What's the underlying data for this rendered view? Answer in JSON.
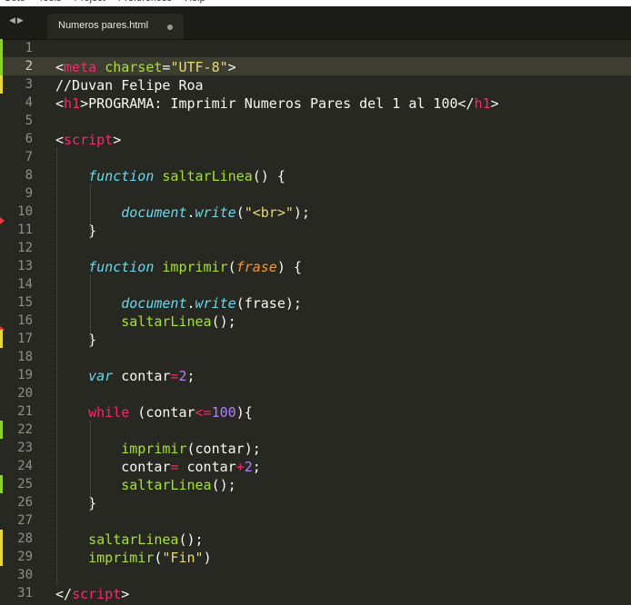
{
  "menu": [
    "Goto",
    "Tools",
    "Project",
    "Preferences",
    "Help"
  ],
  "tab": {
    "title": "Numeros pares.html"
  },
  "lines": [
    {
      "n": "1",
      "tokens": []
    },
    {
      "n": "2",
      "tokens": [
        [
          "c",
          "<"
        ],
        [
          "t",
          "meta"
        ],
        [
          "c",
          " "
        ],
        [
          "a",
          "charset"
        ],
        [
          "c",
          "="
        ],
        [
          "s",
          "\"UTF-8\""
        ],
        [
          "c",
          ">"
        ]
      ]
    },
    {
      "n": "3",
      "tokens": [
        [
          "c",
          "//Duvan Felipe Roa"
        ]
      ]
    },
    {
      "n": "4",
      "tokens": [
        [
          "c",
          "<"
        ],
        [
          "t",
          "h1"
        ],
        [
          "c",
          ">PROGRAMA: Imprimir Numeros Pares del 1 al 100</"
        ],
        [
          "t",
          "h1"
        ],
        [
          "c",
          ">"
        ]
      ]
    },
    {
      "n": "5",
      "tokens": []
    },
    {
      "n": "6",
      "tokens": [
        [
          "c",
          "<"
        ],
        [
          "t",
          "script"
        ],
        [
          "c",
          ">"
        ]
      ]
    },
    {
      "n": "7",
      "tokens": []
    },
    {
      "n": "8",
      "tokens": [
        [
          "c",
          "    "
        ],
        [
          "k",
          "function"
        ],
        [
          "c",
          " "
        ],
        [
          "f",
          "saltarLinea"
        ],
        [
          "c",
          "() {"
        ]
      ]
    },
    {
      "n": "9",
      "tokens": []
    },
    {
      "n": "10",
      "tokens": [
        [
          "c",
          "        "
        ],
        [
          "k",
          "document"
        ],
        [
          "c",
          "."
        ],
        [
          "k",
          "write"
        ],
        [
          "c",
          "("
        ],
        [
          "s",
          "\"<br>\""
        ],
        [
          "c",
          ");"
        ]
      ]
    },
    {
      "n": "11",
      "tokens": [
        [
          "c",
          "    }"
        ]
      ]
    },
    {
      "n": "12",
      "tokens": []
    },
    {
      "n": "13",
      "tokens": [
        [
          "c",
          "    "
        ],
        [
          "k",
          "function"
        ],
        [
          "c",
          " "
        ],
        [
          "f",
          "imprimir"
        ],
        [
          "c",
          "("
        ],
        [
          "p",
          "frase"
        ],
        [
          "c",
          ") {"
        ]
      ]
    },
    {
      "n": "14",
      "tokens": []
    },
    {
      "n": "15",
      "tokens": [
        [
          "c",
          "        "
        ],
        [
          "k",
          "document"
        ],
        [
          "c",
          "."
        ],
        [
          "k",
          "write"
        ],
        [
          "c",
          "(frase);"
        ]
      ]
    },
    {
      "n": "16",
      "tokens": [
        [
          "c",
          "        "
        ],
        [
          "f",
          "saltarLinea"
        ],
        [
          "c",
          "();"
        ]
      ]
    },
    {
      "n": "17",
      "tokens": [
        [
          "c",
          "    }"
        ]
      ]
    },
    {
      "n": "18",
      "tokens": []
    },
    {
      "n": "19",
      "tokens": [
        [
          "c",
          "    "
        ],
        [
          "k",
          "var"
        ],
        [
          "c",
          " contar"
        ],
        [
          "t",
          "="
        ],
        [
          "n",
          "2"
        ],
        [
          "c",
          ";"
        ]
      ]
    },
    {
      "n": "20",
      "tokens": []
    },
    {
      "n": "21",
      "tokens": [
        [
          "c",
          "    "
        ],
        [
          "t",
          "while"
        ],
        [
          "c",
          " (contar"
        ],
        [
          "t",
          "<="
        ],
        [
          "n",
          "100"
        ],
        [
          "c",
          "){"
        ]
      ]
    },
    {
      "n": "22",
      "tokens": []
    },
    {
      "n": "23",
      "tokens": [
        [
          "c",
          "        "
        ],
        [
          "f",
          "imprimir"
        ],
        [
          "c",
          "(contar);"
        ]
      ]
    },
    {
      "n": "24",
      "tokens": [
        [
          "c",
          "        contar"
        ],
        [
          "t",
          "="
        ],
        [
          "c",
          " contar"
        ],
        [
          "t",
          "+"
        ],
        [
          "n",
          "2"
        ],
        [
          "c",
          ";"
        ]
      ]
    },
    {
      "n": "25",
      "tokens": [
        [
          "c",
          "        "
        ],
        [
          "f",
          "saltarLinea"
        ],
        [
          "c",
          "();"
        ]
      ]
    },
    {
      "n": "26",
      "tokens": [
        [
          "c",
          "    }"
        ]
      ]
    },
    {
      "n": "27",
      "tokens": []
    },
    {
      "n": "28",
      "tokens": [
        [
          "c",
          "    "
        ],
        [
          "f",
          "saltarLinea"
        ],
        [
          "c",
          "();"
        ]
      ]
    },
    {
      "n": "29",
      "tokens": [
        [
          "c",
          "    "
        ],
        [
          "f",
          "imprimir"
        ],
        [
          "c",
          "("
        ],
        [
          "s",
          "\"Fin\""
        ],
        [
          "c",
          ")"
        ]
      ]
    },
    {
      "n": "30",
      "tokens": []
    },
    {
      "n": "31",
      "tokens": [
        [
          "c",
          "</"
        ],
        [
          "t",
          "script"
        ],
        [
          "c",
          ">"
        ]
      ]
    }
  ],
  "current_line": "2",
  "gutter_marks": {
    "green": [
      "1",
      "2",
      "22",
      "25"
    ],
    "yellow": [
      "3",
      "17",
      "28",
      "29"
    ],
    "red": [
      "10",
      "16"
    ]
  }
}
